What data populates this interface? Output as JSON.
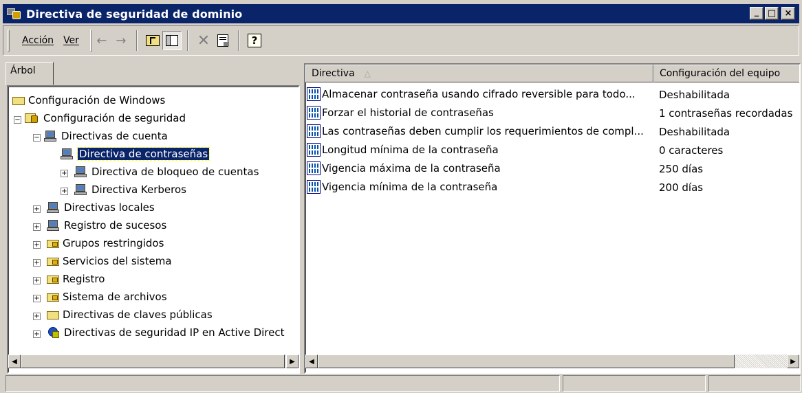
{
  "window": {
    "title": "Directiva de seguridad de dominio",
    "controls": {
      "minimize": "_",
      "maximize": "□",
      "close": "×"
    }
  },
  "menu": {
    "accion": "Acción",
    "ver": "Ver"
  },
  "tree": {
    "tab_label": "Árbol",
    "items": [
      {
        "label": "Configuración de Windows"
      },
      {
        "label": "Configuración de seguridad"
      },
      {
        "label": "Directivas de cuenta"
      },
      {
        "label": "Directiva de contraseñas"
      },
      {
        "label": "Directiva de bloqueo de cuentas"
      },
      {
        "label": "Directiva Kerberos"
      },
      {
        "label": "Directivas locales"
      },
      {
        "label": "Registro de sucesos"
      },
      {
        "label": "Grupos restringidos"
      },
      {
        "label": "Servicios del sistema"
      },
      {
        "label": "Registro"
      },
      {
        "label": "Sistema de archivos"
      },
      {
        "label": "Directivas de claves públicas"
      },
      {
        "label": "Directivas de seguridad IP en Active Direct"
      }
    ]
  },
  "list": {
    "columns": [
      "Directiva",
      "Configuración del equipo"
    ],
    "rows": [
      {
        "policy": "Almacenar contraseña usando cifrado reversible para todo...",
        "setting": "Deshabilitada"
      },
      {
        "policy": "Forzar el historial de contraseñas",
        "setting": "1 contraseñas recordadas"
      },
      {
        "policy": "Las contraseñas deben cumplir los requerimientos de compl...",
        "setting": "Deshabilitada"
      },
      {
        "policy": "Longitud mínima de la contraseña",
        "setting": "0 caracteres"
      },
      {
        "policy": "Vigencia máxima de la contraseña",
        "setting": "250 días"
      },
      {
        "policy": "Vigencia mínima de la contraseña",
        "setting": "200 días"
      }
    ]
  },
  "icons": {
    "back": "←",
    "forward": "→",
    "up": "⮤",
    "delete": "✕",
    "help": "?",
    "scroll_left": "◀",
    "scroll_right": "▶",
    "sort": "△",
    "expand": "+",
    "collapse": "−"
  }
}
